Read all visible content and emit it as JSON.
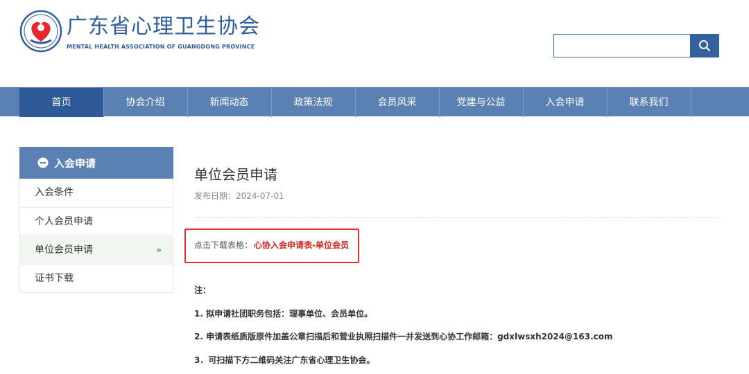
{
  "header": {
    "title_cn": "广东省心理卫生协会",
    "title_en": "MENTAL HEALTH ASSOCIATION OF GUANGDONG PROVINCE",
    "search_placeholder": ""
  },
  "nav": {
    "items": [
      {
        "label": "首页",
        "active": true
      },
      {
        "label": "协会介绍"
      },
      {
        "label": "新闻动态"
      },
      {
        "label": "政策法规"
      },
      {
        "label": "会员风采"
      },
      {
        "label": "党建与公益"
      },
      {
        "label": "入会申请"
      },
      {
        "label": "联系我们"
      }
    ]
  },
  "sidebar": {
    "title": "入会申请",
    "items": [
      {
        "label": "入会条件"
      },
      {
        "label": "个人会员申请"
      },
      {
        "label": "单位会员申请",
        "active": true,
        "arrow": "»"
      },
      {
        "label": "证书下载"
      }
    ]
  },
  "article": {
    "title": "单位会员申请",
    "date": "发布日期：2024-07-01",
    "download_prefix": "点击下载表格：",
    "download_link": "心协入会申请表-单位会员",
    "note_heading": "注：",
    "notes": [
      "1. 拟申请社团职务包括：理事单位、会员单位。",
      "2. 申请表纸质版原件加盖公章扫描后和营业执照扫描件一并发送到心协工作邮箱：gdxlwsxh2024@163.com",
      "3．可扫描下方二维码关注广东省心理卫生协会。"
    ]
  },
  "colors": {
    "brand_blue": "#2f5d9e",
    "nav_bg": "#5b81b4",
    "nav_active": "#2e5a98",
    "highlight_red": "#e8262d",
    "link_red": "#d9251d"
  }
}
